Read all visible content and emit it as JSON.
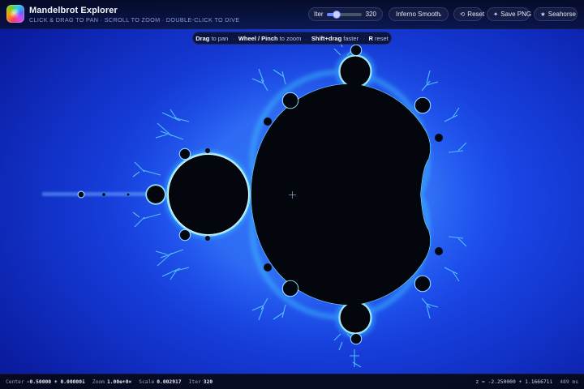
{
  "app": {
    "title": "Mandelbrot Explorer",
    "subtitle": "CLICK & DRAG TO PAN · SCROLL TO ZOOM · DOUBLE-CLICK TO DIVE"
  },
  "toolbar": {
    "iter_label": "Iter",
    "iter_value": "320",
    "iter_fraction": 0.3,
    "palette_selected": "Inferno Smooth",
    "reset_label": "Reset",
    "save_label": "Save PNG",
    "seahorse_label": "Seahorse"
  },
  "hint": {
    "drag_key": "Drag",
    "drag_text": "to pan",
    "wheel_key": "Wheel / Pinch",
    "wheel_text": "to zoom",
    "shift_key": "Shift+drag",
    "shift_text": "faster",
    "r_key": "R",
    "r_text": "reset"
  },
  "status": {
    "center_label": "Center",
    "center_value": "-0.50000 + 0.00000i",
    "zoom_label": "Zoom",
    "zoom_value": "1.00e+0×",
    "scale_label": "Scale",
    "scale_value": "0.002917",
    "iter_label": "Iter",
    "iter_value": "320",
    "pointer_value": "z = -2.250000 + 1.166671i",
    "render_time": "489 ms"
  },
  "colors": {
    "set_interior": "#04060d",
    "background_deep": "#0a1b9e",
    "background_mid": "#1d4cf0",
    "halo_glow": "#2f6bff",
    "edge_cyan": "#43c8ff",
    "edge_light": "#c6f2ff",
    "accent": "#6b8cff"
  }
}
